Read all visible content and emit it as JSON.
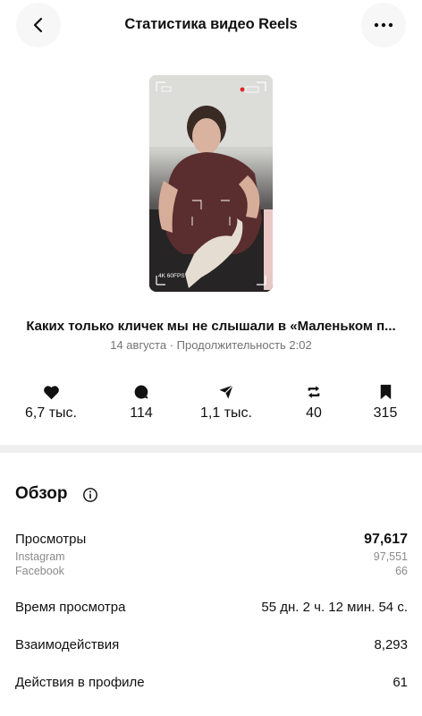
{
  "header": {
    "title": "Статистика видео Reels",
    "back_icon": "chevron-left-icon",
    "more_icon": "more-horizontal-icon"
  },
  "video": {
    "overlay_text": "4K 60FPS"
  },
  "post": {
    "caption": "Каких только кличек мы не слышали в «Маленьком п...",
    "meta": "14 августа · Продолжительность 2:02"
  },
  "stats": [
    {
      "icon": "heart-icon",
      "value": "6,7 тыс."
    },
    {
      "icon": "comment-icon",
      "value": "114"
    },
    {
      "icon": "send-icon",
      "value": "1,1 тыс."
    },
    {
      "icon": "repost-icon",
      "value": "40"
    },
    {
      "icon": "bookmark-icon",
      "value": "315"
    }
  ],
  "overview": {
    "title": "Обзор",
    "info_icon": "info-icon",
    "views": {
      "label": "Просмотры",
      "value": "97,617",
      "breakdown": [
        {
          "label": "Instagram",
          "value": "97,551"
        },
        {
          "label": "Facebook",
          "value": "66"
        }
      ]
    },
    "watch_time": {
      "label": "Время просмотра",
      "value": "55 дн. 2 ч. 12 мин. 54 с."
    },
    "interactions": {
      "label": "Взаимодействия",
      "value": "8,293"
    },
    "profile_actions": {
      "label": "Действия в профиле",
      "value": "61"
    }
  }
}
